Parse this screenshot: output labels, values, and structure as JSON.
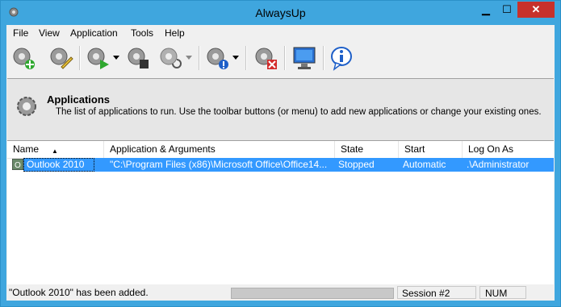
{
  "window": {
    "title": "AlwaysUp",
    "controls": {
      "minimize": "▁",
      "maximize": "☐",
      "close": "✕"
    }
  },
  "menubar": {
    "items": [
      "File",
      "View",
      "Application",
      "Tools",
      "Help"
    ]
  },
  "toolbar": {
    "buttons": [
      {
        "name": "add-application",
        "icon": "gear-plus-icon"
      },
      {
        "name": "edit-application",
        "icon": "gear-pencil-icon"
      },
      {
        "name": "start-application",
        "icon": "gear-play-icon",
        "has_dropdown": true
      },
      {
        "name": "stop-application",
        "icon": "gear-stop-icon"
      },
      {
        "name": "restart-application",
        "icon": "gear-restart-icon",
        "has_dropdown": true
      },
      {
        "name": "report-application",
        "icon": "gear-info-icon",
        "has_dropdown": true
      },
      {
        "name": "remove-application",
        "icon": "gear-delete-icon"
      },
      {
        "name": "console",
        "icon": "monitor-icon"
      },
      {
        "name": "about",
        "icon": "info-icon"
      }
    ]
  },
  "header": {
    "title": "Applications",
    "description": "The list of applications to run. Use the toolbar buttons (or menu) to add new applications or change your existing ones."
  },
  "list": {
    "columns": [
      "Name",
      "Application & Arguments",
      "State",
      "Start",
      "Log On As"
    ],
    "sorted_column": "Name",
    "rows": [
      {
        "name": "Outlook 2010",
        "application": "\"C:\\Program Files (x86)\\Microsoft Office\\Office14...",
        "state": "Stopped",
        "start": "Automatic",
        "logon": ".\\Administrator",
        "selected": true
      }
    ]
  },
  "statusbar": {
    "message": "\"Outlook 2010\" has been added.",
    "session": "Session #2",
    "num": "NUM"
  },
  "colors": {
    "title_bar": "#3fa6de",
    "selection": "#3399ff",
    "close_button": "#c7312b"
  }
}
